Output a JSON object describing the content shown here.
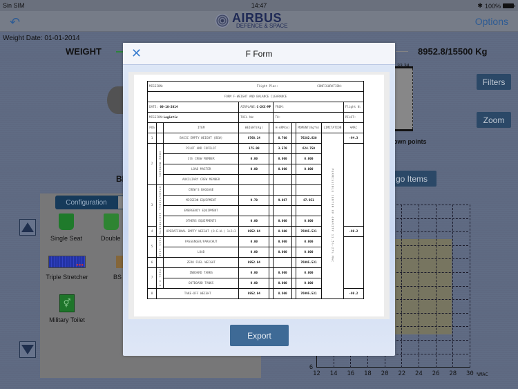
{
  "status_bar": {
    "carrier": "Sin SIM",
    "time": "14:47",
    "battery": "100%"
  },
  "nav": {
    "back_icon": "reply-arrow-icon",
    "logo_main": "AIRBUS",
    "logo_sub": "DEFENCE & SPACE",
    "options_label": "Options"
  },
  "background": {
    "weight_date": "Weight Date: 01-01-2014",
    "weight_label": "WEIGHT",
    "weight_value": "8952.8/15500 Kg",
    "weight_progress": 0.578,
    "seat_numbers": "33 34",
    "bl_text": "BL",
    "down_points": "own points",
    "filters_label": "Filters",
    "zoom_label": "Zoom",
    "cargo_items_label": "go Items",
    "config_tab_label": "Configuration",
    "config_items": [
      {
        "label": "Single Seat",
        "icon": "single-seat-icon"
      },
      {
        "label": "Double",
        "icon": "double-seat-icon"
      },
      {
        "label": "Triple Stretcher",
        "icon": "triple-stretcher-icon"
      },
      {
        "label": "BS",
        "icon": "bs-icon"
      },
      {
        "label": "Military Toilet",
        "icon": "military-toilet-icon",
        "glyph": "🚻"
      }
    ],
    "chart": {
      "x_ticks": [
        "12",
        "14",
        "16",
        "18",
        "20",
        "22",
        "24",
        "26",
        "28",
        "30"
      ],
      "x_unit": "%MAC",
      "y_tick": "6"
    }
  },
  "modal": {
    "title": "F Form",
    "export_label": "Export",
    "form": {
      "mission_label": "MISSION:",
      "flight_plan_label": "Flight Plan:",
      "configuration_label": "CONFIGURATION:",
      "form_title": "FORM F-WEIGHT AND BALANCE CLEARANCE",
      "date_label": "DATE:",
      "date_value": "09-10-2014",
      "airplane_label": "AIRPLANE:",
      "airplane_value": "C-2XX-MP",
      "from_label": "FROM:",
      "flight_n_label": "Flight N:",
      "mission2_label": "MISSION:",
      "mission2_value": "Logistic",
      "tail_label": "TAIL No:",
      "to_label": "TO:",
      "pilot_label": "PILOT:",
      "headers": [
        "POS",
        "ITEM",
        "WEIGHT(Kg)",
        "H-ARM(m)",
        "MOMENT(Kg*m)",
        "LIMITATION",
        "%MAC"
      ],
      "limitation_text": "PERMISSIBLE CENTER OF GRAVITY 11.5%-27% MAC",
      "groups": {
        "crew": "CREW MEMBERS",
        "oper": "OPERATIONAL EQUIPMENTS",
        "pass": "PASS LOAD",
        "fuel": "FUEL I-O"
      },
      "rows": [
        {
          "pos": "1",
          "item": "BASIC EMPTY WEIGHT (BEW)",
          "weight": "8768.14",
          "arm": "8.700",
          "moment": "76282.820",
          "mac": "-94.3"
        },
        {
          "pos": "2",
          "item": "PILOT AND COPILOT",
          "weight": "175.00",
          "arm": "3.570",
          "moment": "624.750",
          "mac": ""
        },
        {
          "pos": "",
          "item": "3th CREW MEMBER",
          "weight": "0.00",
          "arm": "0.000",
          "moment": "0.000",
          "mac": ""
        },
        {
          "pos": "",
          "item": "LOAD MASTER",
          "weight": "0.00",
          "arm": "0.000",
          "moment": "0.000",
          "mac": ""
        },
        {
          "pos": "",
          "item": "AUXILIARY CREW MEMBER",
          "weight": "",
          "arm": "",
          "moment": "",
          "mac": ""
        },
        {
          "pos": "3",
          "item": "CREW'S BAGGAGE",
          "weight": "",
          "arm": "",
          "moment": "",
          "mac": ""
        },
        {
          "pos": "",
          "item": "MISSION EQUIPMENT",
          "weight": "9.70",
          "arm": "9.067",
          "moment": "87.951",
          "mac": ""
        },
        {
          "pos": "",
          "item": "EMERGENCY EQUIPMENT",
          "weight": "",
          "arm": "",
          "moment": "",
          "mac": ""
        },
        {
          "pos": "",
          "item": "OTHERS EQUIPMENTS",
          "weight": "0.00",
          "arm": "0.000",
          "moment": "0.000",
          "mac": ""
        },
        {
          "pos": "4",
          "item": "OPERATIONAL EMPTY WEIGHT (O.E.W.) 1+2+3",
          "weight": "8952.84",
          "arm": "8.600",
          "moment": "76995.531",
          "mac": "-98.2"
        },
        {
          "pos": "5",
          "item": "PASSENGER/PARACHUT",
          "weight": "0.00",
          "arm": "0.000",
          "moment": "0.000",
          "mac": ""
        },
        {
          "pos": "",
          "item": "LOAD",
          "weight": "0.00",
          "arm": "0.000",
          "moment": "0.000",
          "mac": ""
        },
        {
          "pos": "6",
          "item": "ZERO FUEL WEIGHT",
          "weight": "8952.84",
          "arm": "",
          "moment": "76995.531",
          "mac": ""
        },
        {
          "pos": "7",
          "item": "INBOARD TANKS",
          "weight": "0.00",
          "arm": "0.000",
          "moment": "0.000",
          "mac": ""
        },
        {
          "pos": "",
          "item": "OUTBOARD TANKS",
          "weight": "0.00",
          "arm": "0.000",
          "moment": "0.000",
          "mac": ""
        },
        {
          "pos": "8",
          "item": "TAKE-OFF WEIGHT",
          "weight": "8952.84",
          "arm": "8.600",
          "moment": "76995.531",
          "mac": "-98.2"
        }
      ]
    }
  }
}
